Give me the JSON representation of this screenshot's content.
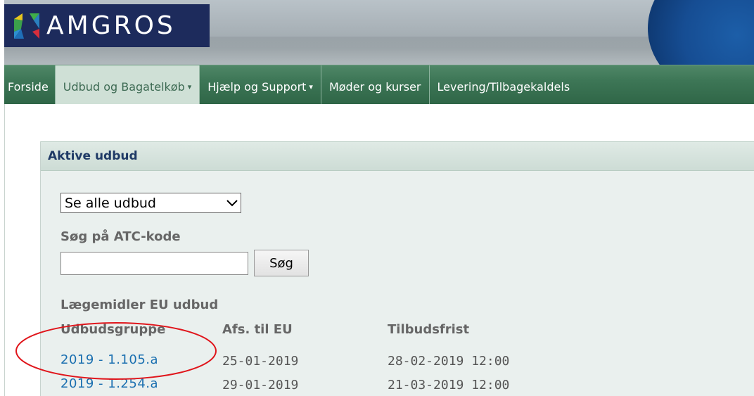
{
  "header": {
    "logo_text": "AMGROS",
    "logo_colors": {
      "background": "#1d2b5c",
      "yellow": "#e8c51e",
      "green": "#3fae49",
      "blue": "#2d8fd0",
      "red": "#d62e3c"
    }
  },
  "nav": {
    "items": [
      {
        "label": "Forside",
        "dropdown": false,
        "active": false
      },
      {
        "label": "Udbud og Bagatelkøb",
        "dropdown": true,
        "active": true
      },
      {
        "label": "Hjælp og Support",
        "dropdown": true,
        "active": false
      },
      {
        "label": "Møder og kurser",
        "dropdown": false,
        "active": false
      },
      {
        "label": "Levering/Tilbagekaldels",
        "dropdown": false,
        "active": false
      }
    ],
    "caret": "▾"
  },
  "panel": {
    "title": "Aktive udbud",
    "filter_select": {
      "value": "Se alle udbud"
    },
    "atc_label": "Søg på ATC-kode",
    "search_input": {
      "value": ""
    },
    "search_button": "Søg",
    "section_label": "Lægemidler EU udbud",
    "table": {
      "headers": [
        "Udbudsgruppe",
        "Afs. til EU",
        "Tilbudsfrist"
      ],
      "rows": [
        [
          "2019 - 1.105.a",
          "25-01-2019",
          "28-02-2019 12:00"
        ],
        [
          "2019 - 1.254.a",
          "29-01-2019",
          "21-03-2019 12:00"
        ]
      ]
    }
  },
  "annotation": {
    "shape": "ellipse",
    "color": "#e0151b",
    "target": "Udbudsgruppe column, first row"
  }
}
